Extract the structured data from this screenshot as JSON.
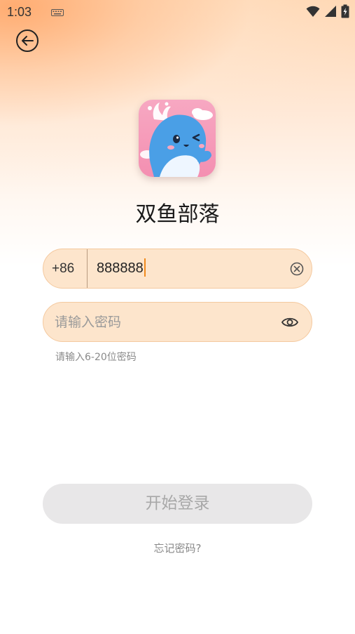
{
  "status_bar": {
    "time": "1:03"
  },
  "app": {
    "name": "双鱼部落"
  },
  "phone": {
    "country_code": "+86",
    "value": "888888"
  },
  "password": {
    "placeholder": "请输入密码",
    "hint": "请输入6-20位密码"
  },
  "actions": {
    "login_label": "开始登录",
    "forgot_label": "忘记密码?"
  },
  "colors": {
    "accent": "#f08a1c",
    "field_bg": "#fde5cc",
    "button_disabled": "#e8e7e8"
  }
}
